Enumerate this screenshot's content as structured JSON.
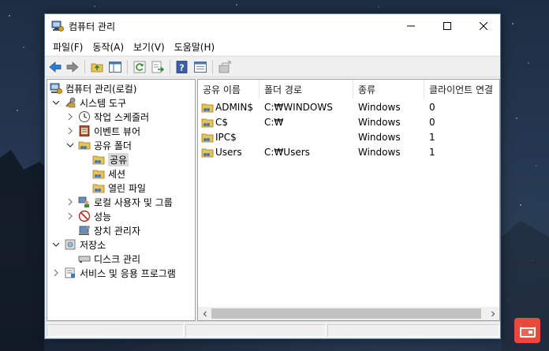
{
  "window": {
    "title": "컴퓨터 관리",
    "icons": {
      "app": "computer-management-icon",
      "minimize": "minimize-icon",
      "maximize": "maximize-icon",
      "close": "close-icon"
    }
  },
  "menu": {
    "items": [
      "파일(F)",
      "동작(A)",
      "보기(V)",
      "도움말(H)"
    ]
  },
  "toolbar": {
    "buttons": [
      "back-icon",
      "forward-icon",
      "up-folder-icon",
      "show-hide-tree-icon",
      "refresh-icon",
      "export-list-icon",
      "help-icon",
      "properties-icon",
      "action-icon"
    ]
  },
  "tree": {
    "root": "컴퓨터 관리(로컬)",
    "system_tools": "시스템 도구",
    "task_scheduler": "작업 스케줄러",
    "event_viewer": "이벤트 뷰어",
    "shared_folders": "공유 폴더",
    "shares": "공유",
    "sessions": "세션",
    "open_files": "열린 파일",
    "local_users": "로컬 사용자 및 그룹",
    "performance": "성능",
    "device_manager": "장치 관리자",
    "storage": "저장소",
    "disk_management": "디스크 관리",
    "services_apps": "서비스 및 응용 프로그램"
  },
  "list": {
    "columns": [
      "공유 이름",
      "폴더 경로",
      "종류",
      "클라이언트 연결"
    ],
    "rows": [
      {
        "name": "ADMIN$",
        "path": "C:₩WINDOWS",
        "type": "Windows",
        "clients": "0"
      },
      {
        "name": "C$",
        "path": "C:₩",
        "type": "Windows",
        "clients": "0"
      },
      {
        "name": "IPC$",
        "path": "",
        "type": "Windows",
        "clients": "1"
      },
      {
        "name": "Users",
        "path": "C:₩Users",
        "type": "Windows",
        "clients": "1"
      }
    ]
  },
  "colors": {
    "accent": "#0078d7",
    "tray": "#e84a3a",
    "desktop": "#24364f"
  }
}
